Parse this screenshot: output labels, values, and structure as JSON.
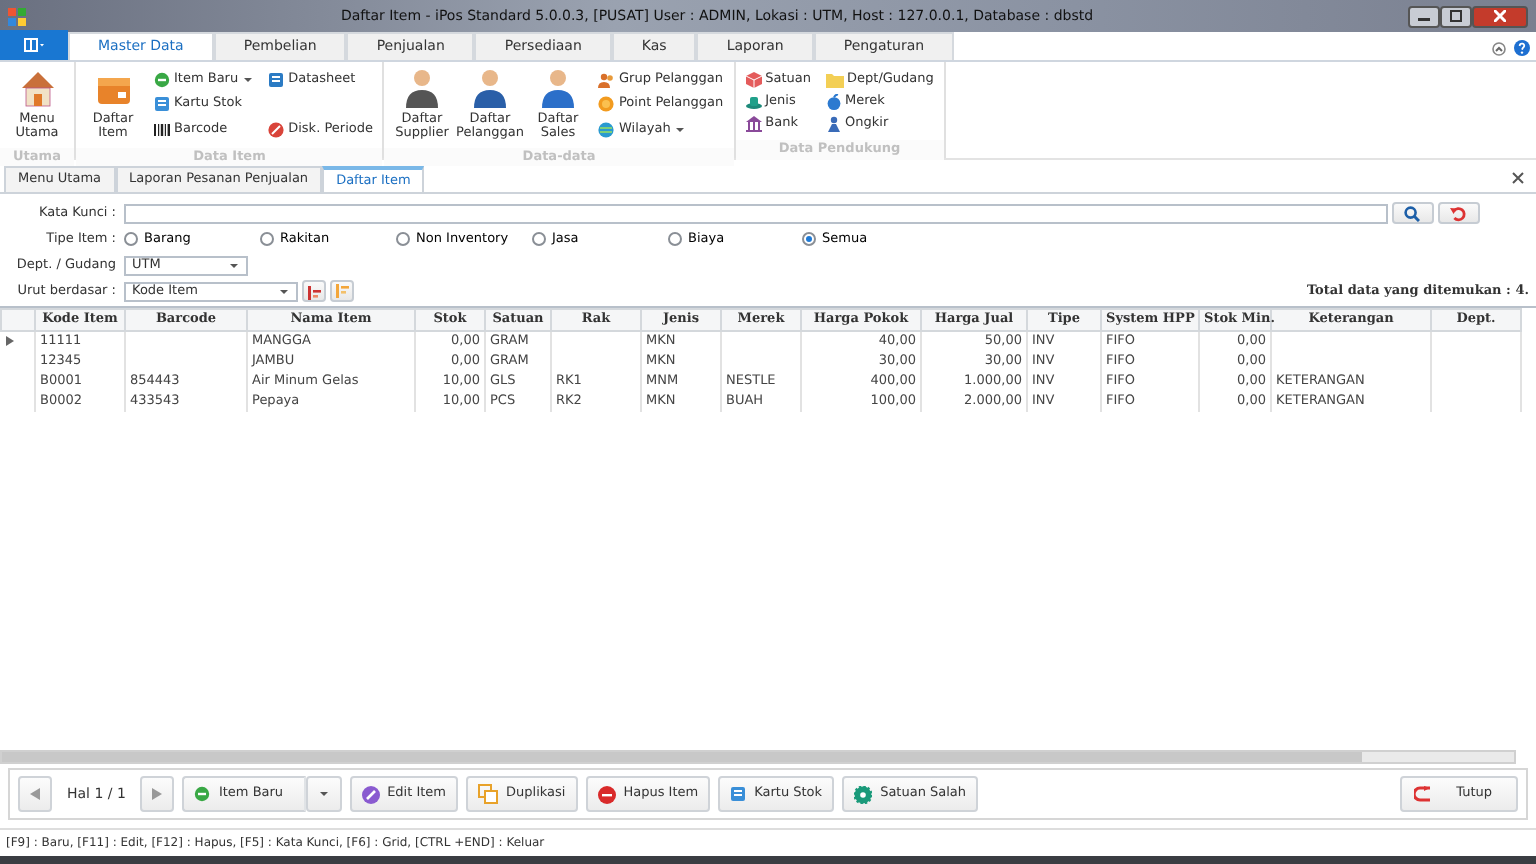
{
  "window": {
    "title": "Daftar Item - iPos Standard 5.0.0.3, [PUSAT] User : ADMIN, Lokasi : UTM, Host : 127.0.0.1, Database : dbstd"
  },
  "menu_tabs": [
    {
      "label": "Master Data",
      "selected": true
    },
    {
      "label": "Pembelian",
      "selected": false
    },
    {
      "label": "Penjualan",
      "selected": false
    },
    {
      "label": "Persediaan",
      "selected": false
    },
    {
      "label": "Kas",
      "selected": false
    },
    {
      "label": "Laporan",
      "selected": false
    },
    {
      "label": "Pengaturan",
      "selected": false
    }
  ],
  "ribbon": [
    {
      "label": "Utama",
      "large": [
        {
          "label": "Menu Utama"
        }
      ]
    },
    {
      "label": "Data Item",
      "large": [
        {
          "label": "Daftar Item"
        }
      ],
      "small": [
        {
          "label": "Item Baru",
          "dropdown": true
        },
        {
          "label": "Kartu Stok",
          "dropdown": false
        },
        {
          "label": "Barcode",
          "dropdown": false
        },
        {
          "label": "Datasheet",
          "dropdown": false
        },
        {
          "label": "Disk. Periode",
          "dropdown": false
        }
      ]
    },
    {
      "label": "Data-data",
      "large": [
        {
          "label": "Daftar Supplier"
        },
        {
          "label": "Daftar Pelanggan"
        },
        {
          "label": "Daftar Sales"
        }
      ],
      "small": [
        {
          "label": "Grup Pelanggan",
          "dropdown": false
        },
        {
          "label": "Point Pelanggan",
          "dropdown": false
        },
        {
          "label": "Wilayah",
          "dropdown": true
        }
      ]
    },
    {
      "label": "Data Pendukung",
      "small": [
        {
          "label": "Satuan",
          "dropdown": false
        },
        {
          "label": "Jenis",
          "dropdown": false
        },
        {
          "label": "Bank",
          "dropdown": false
        },
        {
          "label": "Dept/Gudang",
          "dropdown": false
        },
        {
          "label": "Merek",
          "dropdown": false
        },
        {
          "label": "Ongkir",
          "dropdown": false
        }
      ]
    }
  ],
  "doc_tabs": [
    {
      "label": "Menu Utama",
      "selected": false
    },
    {
      "label": "Laporan Pesanan Penjualan",
      "selected": false
    },
    {
      "label": "Daftar Item",
      "selected": true
    }
  ],
  "form": {
    "keyword_label": "Kata Kunci :",
    "type_label": "Tipe Item :",
    "types": [
      {
        "label": "Barang",
        "selected": false
      },
      {
        "label": "Rakitan",
        "selected": false
      },
      {
        "label": "Non Inventory",
        "selected": false
      },
      {
        "label": "Jasa",
        "selected": false
      },
      {
        "label": "Biaya",
        "selected": false
      },
      {
        "label": "Semua",
        "selected": true
      }
    ],
    "dept_label": "Dept. / Gudang",
    "dept_value": "UTM",
    "sort_label": "Urut berdasar :",
    "sort_value": "Kode Item",
    "total": "Total data yang ditemukan : 4."
  },
  "table": {
    "columns": [
      "Kode Item",
      "Barcode",
      "Nama Item",
      "Stok",
      "Satuan",
      "Rak",
      "Jenis",
      "Merek",
      "Harga Pokok",
      "Harga Jual",
      "Tipe",
      "System HPP",
      "Stok Min.",
      "Keterangan",
      "Dept."
    ],
    "rows": [
      {
        "current": true,
        "cells": [
          "11111",
          "",
          "MANGGA",
          "0,00",
          "GRAM",
          "",
          "MKN",
          "",
          "40,00",
          "50,00",
          "INV",
          "FIFO",
          "0,00",
          "",
          ""
        ]
      },
      {
        "current": false,
        "cells": [
          "12345",
          "",
          "JAMBU",
          "0,00",
          "GRAM",
          "",
          "MKN",
          "",
          "30,00",
          "30,00",
          "INV",
          "FIFO",
          "0,00",
          "",
          ""
        ]
      },
      {
        "current": false,
        "cells": [
          "B0001",
          "854443",
          "Air Minum Gelas",
          "10,00",
          "GLS",
          "RK1",
          "MNM",
          "NESTLE",
          "400,00",
          "1.000,00",
          "INV",
          "FIFO",
          "0,00",
          "KETERANGAN",
          ""
        ]
      },
      {
        "current": false,
        "cells": [
          "B0002",
          "433543",
          "Pepaya",
          "10,00",
          "PCS",
          "RK2",
          "MKN",
          "BUAH",
          "100,00",
          "2.000,00",
          "INV",
          "FIFO",
          "0,00",
          "KETERANGAN",
          ""
        ]
      }
    ]
  },
  "toolbar": {
    "page": "Hal 1 / 1",
    "buttons": [
      {
        "label": "Item Baru",
        "dropdown": true
      },
      {
        "label": "Edit Item",
        "dropdown": false
      },
      {
        "label": "Duplikasi",
        "dropdown": false
      },
      {
        "label": "Hapus Item",
        "dropdown": false
      },
      {
        "label": "Kartu Stok",
        "dropdown": false
      },
      {
        "label": "Satuan Salah",
        "dropdown": false
      }
    ],
    "close": "Tutup"
  },
  "status_bar": "[F9] : Baru, [F11] : Edit, [F12] : Hapus, [F5] : Kata Kunci, [F6] : Grid, [CTRL +END] : Keluar"
}
